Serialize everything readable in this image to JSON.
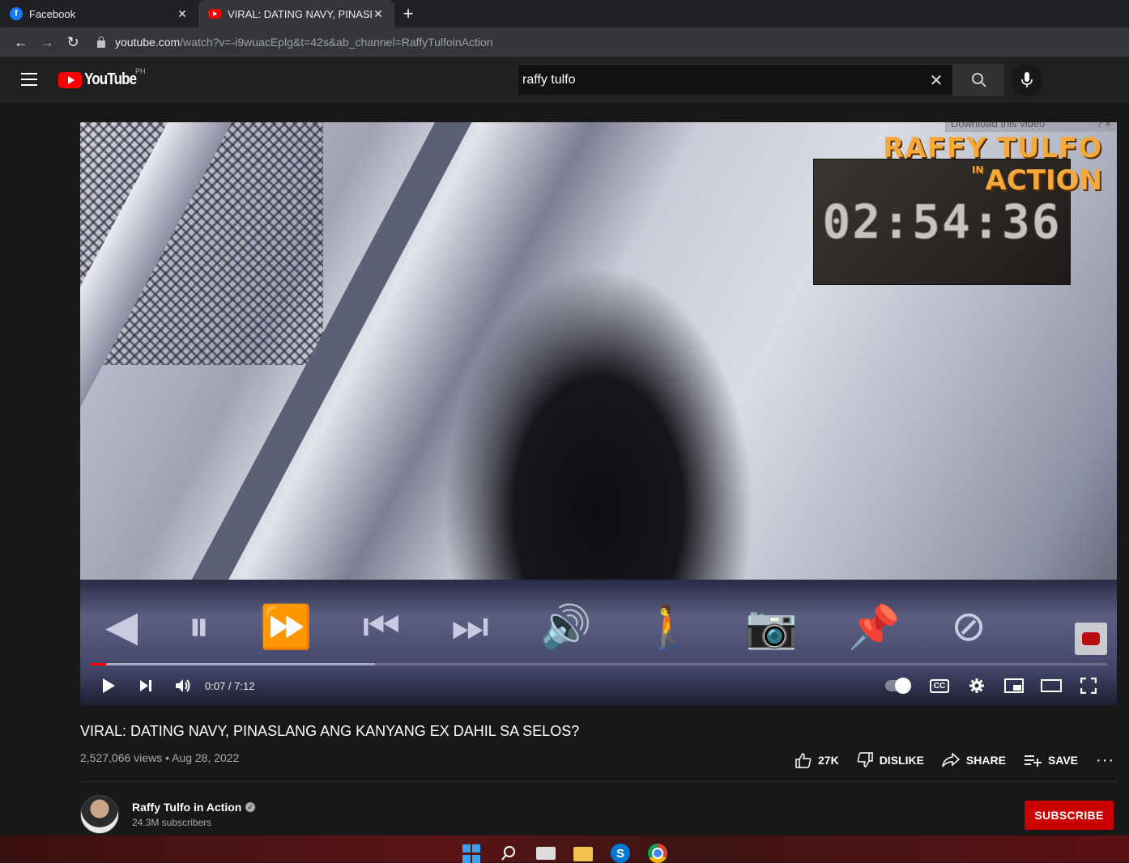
{
  "browser": {
    "tabs": [
      {
        "title": "Facebook",
        "favicon": "facebook-icon",
        "active": false
      },
      {
        "title": "VIRAL: DATING NAVY, PINASLAN",
        "favicon": "youtube-icon",
        "active": true
      }
    ],
    "url_host": "youtube.com",
    "url_path": "/watch?v=-i9wuacEplg&t=42s&ab_channel=RaffyTulfoinAction"
  },
  "header": {
    "logo_text": "YouTube",
    "country_code": "PH",
    "search_value": "raffy tulfo"
  },
  "player": {
    "overlay_brand_line1": "RAFFY TULFO",
    "overlay_brand_in": "IN",
    "overlay_brand_line2": "ACTION",
    "overlay_clock": "02:54:36",
    "download_bar_label": "Download this video",
    "download_bar_help": "? ×",
    "timecode": "0:07 / 7:12",
    "progress_played": 0.016,
    "progress_buffered": 0.28,
    "accent": "#ff0000"
  },
  "video": {
    "title": "VIRAL: DATING NAVY, PINASLANG ANG KANYANG EX DAHIL SA SELOS?",
    "views_date": "2,527,066 views • Aug 28, 2022",
    "like_count": "27K",
    "dislike_label": "DISLIKE",
    "share_label": "SHARE",
    "save_label": "SAVE",
    "more_label": "···"
  },
  "channel": {
    "name": "Raffy Tulfo in Action",
    "subscribers": "24.3M subscribers",
    "subscribe_label": "SUBSCRIBE",
    "subscribe_color": "#cc0000"
  },
  "taskbar": {
    "skype_letter": "S"
  }
}
